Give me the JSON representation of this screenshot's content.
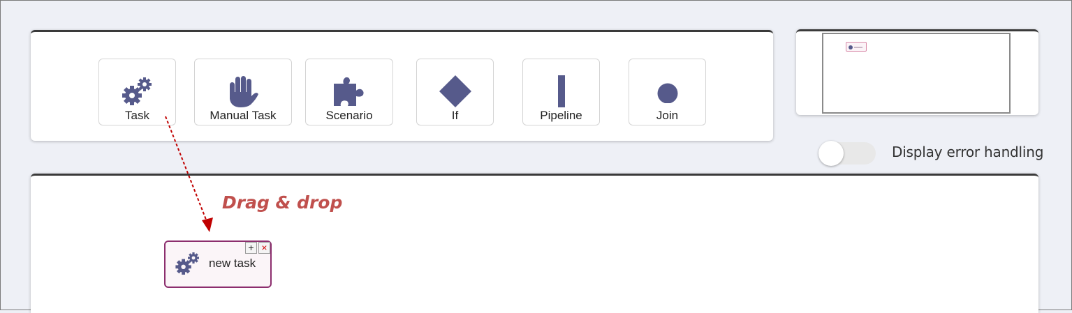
{
  "palette": {
    "tools": [
      {
        "label": "Task",
        "icon": "gears-icon"
      },
      {
        "label": "Manual Task",
        "icon": "hand-icon"
      },
      {
        "label": "Scenario",
        "icon": "puzzle-icon"
      },
      {
        "label": "If",
        "icon": "diamond-icon"
      },
      {
        "label": "Pipeline",
        "icon": "bar-icon"
      },
      {
        "label": "Join",
        "icon": "circle-icon"
      }
    ]
  },
  "error_handling": {
    "label": "Display error handling",
    "enabled": false
  },
  "annotation": {
    "text": "Drag & drop"
  },
  "canvas": {
    "node": {
      "label": "new task",
      "add_symbol": "+",
      "remove_symbol": "×",
      "icon": "gears-icon"
    }
  },
  "colors": {
    "icon": "#565a8b",
    "annotation": "#c0504d",
    "node_border": "#8c2e6e",
    "arrow": "#c00000"
  }
}
